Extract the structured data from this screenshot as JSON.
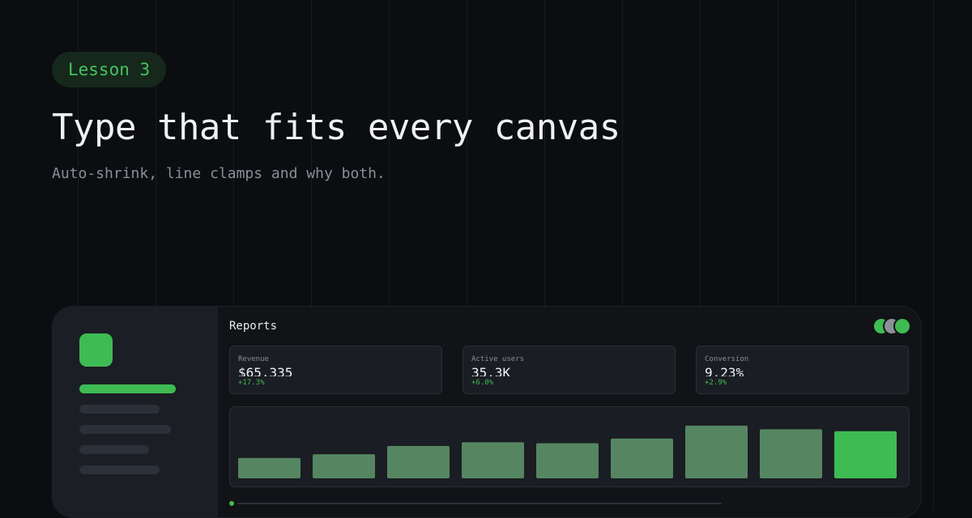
{
  "colors": {
    "accent": "#3fbb53",
    "bar": "#558661",
    "background": "#0b0d11"
  },
  "hero": {
    "badge": "Lesson 3",
    "title": "Type that fits every canvas",
    "subtitle": "Auto-shrink, line clamps and why both."
  },
  "dashboard": {
    "title": "Reports",
    "avatars": [
      "#3fbb53",
      "#8c9097",
      "#3fbb53"
    ],
    "nav_items": [
      {
        "active": true
      },
      {
        "active": false
      },
      {
        "active": false
      },
      {
        "active": false
      },
      {
        "active": false
      }
    ],
    "kpis": [
      {
        "label": "Revenue",
        "value": "$65,335",
        "delta": "+17.3%"
      },
      {
        "label": "Active users",
        "value": "35.3K",
        "delta": "+6.0%"
      },
      {
        "label": "Conversion",
        "value": "9.23%",
        "delta": "+2.9%"
      }
    ]
  },
  "chart_data": {
    "type": "bar",
    "values": [
      22,
      26,
      35,
      39,
      38,
      43,
      57,
      53,
      51
    ],
    "highlight_index": 8,
    "ylim": [
      0,
      70
    ],
    "grid": false
  }
}
